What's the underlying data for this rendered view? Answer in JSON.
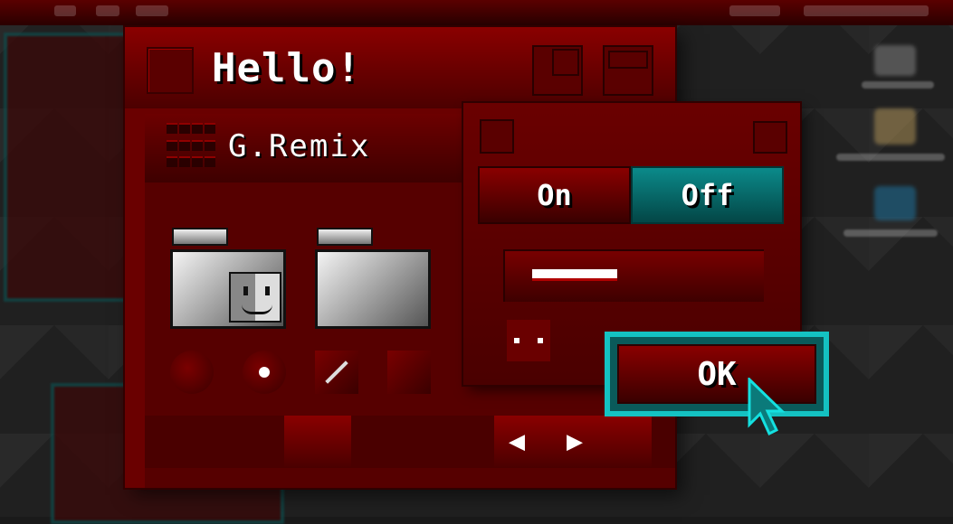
{
  "window": {
    "title": "Hello!",
    "theme_name": "G.Remix"
  },
  "toggle": {
    "on_label": "On",
    "off_label": "Off",
    "selected": "Off"
  },
  "slider": {
    "value_fraction": 0.38
  },
  "dialog": {
    "ok_label": "OK"
  },
  "icons": {
    "grid": "grid-icon",
    "finder": "finder-face-icon",
    "pencil": "pencil-icon",
    "left": "arrow-left-icon",
    "right": "arrow-right-icon",
    "cursor": "mouse-pointer-icon"
  },
  "colors": {
    "primary": "#6a0000",
    "accent": "#14c2c2",
    "selected_segment": "#0b8a8a"
  }
}
